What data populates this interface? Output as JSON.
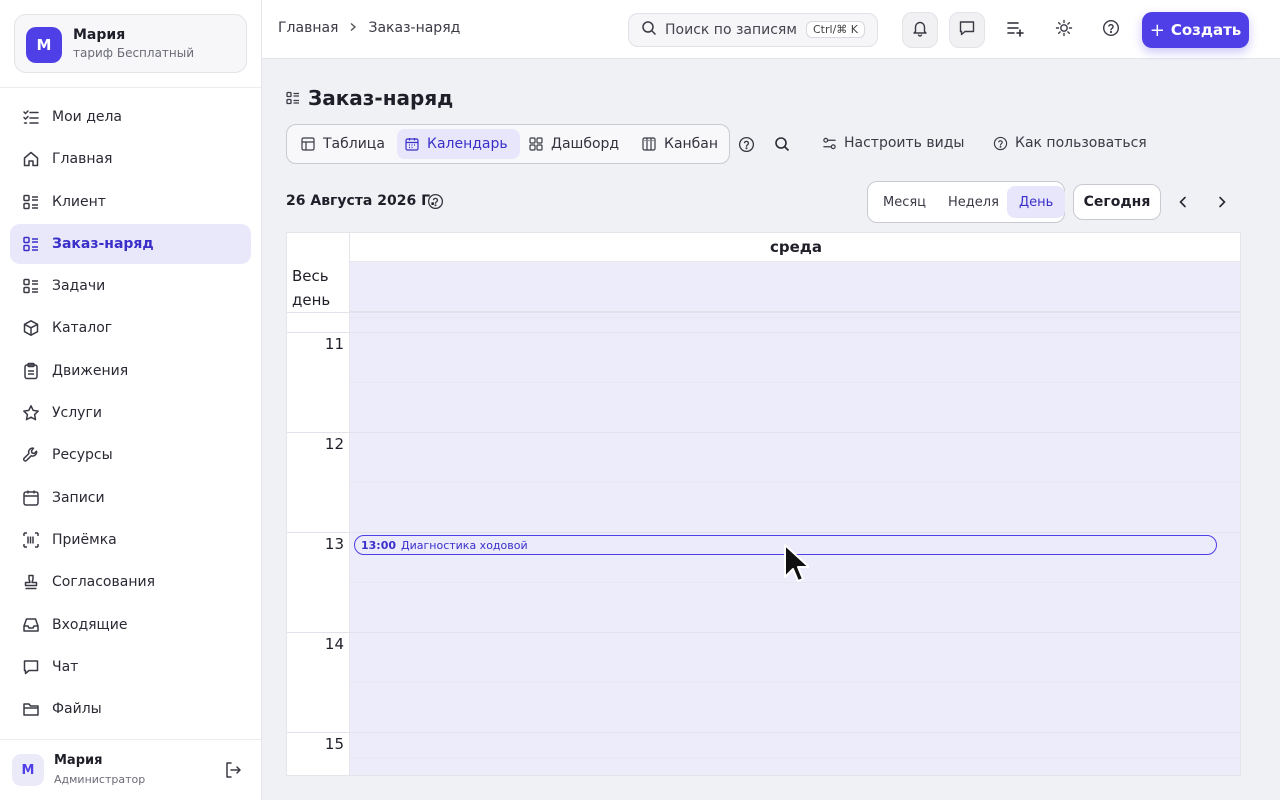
{
  "account": {
    "initial": "М",
    "name": "Мария",
    "plan": "тариф Бесплатный"
  },
  "sidebar": {
    "items": [
      {
        "label": "Мои дела",
        "icon": "checklist-icon"
      },
      {
        "label": "Главная",
        "icon": "home-icon"
      },
      {
        "label": "Клиент",
        "icon": "list-icon"
      },
      {
        "label": "Заказ-наряд",
        "icon": "list-icon",
        "active": true
      },
      {
        "label": "Задачи",
        "icon": "list-icon"
      },
      {
        "label": "Каталог",
        "icon": "box-icon"
      },
      {
        "label": "Движения",
        "icon": "clipboard-icon"
      },
      {
        "label": "Услуги",
        "icon": "star-icon"
      },
      {
        "label": "Ресурсы",
        "icon": "wrench-icon"
      },
      {
        "label": "Записи",
        "icon": "calendar-icon"
      },
      {
        "label": "Приёмка",
        "icon": "barcode-icon"
      },
      {
        "label": "Согласования",
        "icon": "stamp-icon"
      },
      {
        "label": "Входящие",
        "icon": "inbox-icon"
      },
      {
        "label": "Чат",
        "icon": "chat-icon"
      },
      {
        "label": "Файлы",
        "icon": "folder-icon"
      }
    ]
  },
  "user": {
    "initial": "М",
    "name": "Мария",
    "role": "Администратор"
  },
  "topbar": {
    "breadcrumb": [
      "Главная",
      "Заказ-наряд"
    ],
    "search_placeholder": "Поиск по записям",
    "search_hotkey": "Ctrl/⌘ K",
    "create_label": "Создать"
  },
  "page": {
    "title": "Заказ-наряд",
    "views": [
      "Таблица",
      "Календарь",
      "Дашборд",
      "Канбан"
    ],
    "active_view": "Календарь",
    "configure_views": "Настроить виды",
    "how_to_use": "Как пользоваться"
  },
  "calendar": {
    "date": "26 Августа 2026 Г.",
    "ranges": [
      "Месяц",
      "Неделя",
      "День"
    ],
    "active_range": "День",
    "today_label": "Сегодня",
    "weekday": "среда",
    "all_day_label": "Весь день",
    "hours": [
      "11",
      "12",
      "13",
      "14",
      "15"
    ],
    "events": [
      {
        "time": "13:00",
        "title": "Диагностика ходовой"
      }
    ]
  },
  "colors": {
    "accent": "#4f3fe6",
    "slot_bg": "#ececfb",
    "active_bg": "#e9e8fb"
  }
}
